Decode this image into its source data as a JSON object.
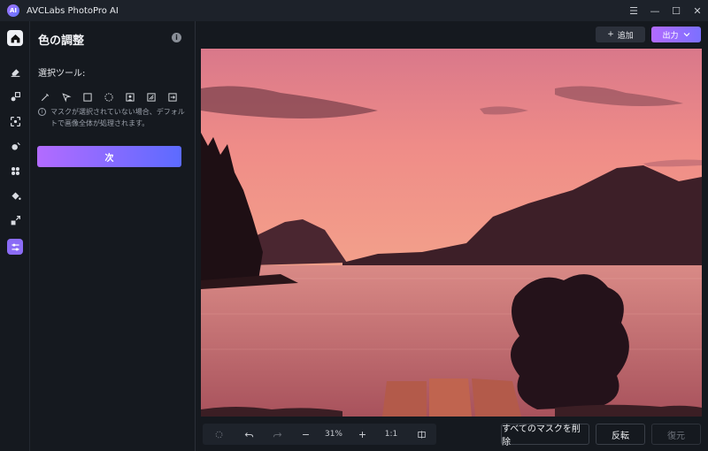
{
  "app": {
    "logo_text": "AI",
    "title": "AVCLabs PhotoPro AI"
  },
  "window_controls": {
    "menu": "☰",
    "minimize": "—",
    "maximize": "☐",
    "close": "✕"
  },
  "rail": {
    "items": [
      "home",
      "eraser",
      "object-replace",
      "enhance",
      "colorize",
      "bokeh",
      "fill",
      "upscale",
      "color-adjust"
    ],
    "active": "color-adjust"
  },
  "panel": {
    "title": "色の調整",
    "info": "i",
    "section_label": "選択ツール:",
    "tools": [
      "brush",
      "lasso",
      "rectangle",
      "ellipse",
      "portrait",
      "auto",
      "exit"
    ],
    "hint": "マスクが選択されていない場合、デフォルトで画像全体が処理されます。",
    "next_label": "次"
  },
  "toolbar": {
    "add_label": "追加",
    "add_prefix": "+",
    "export_label": "出力"
  },
  "zoom": {
    "level": "31%",
    "ratio": "1:1"
  },
  "actions": {
    "delete_masks": "すべてのマスクを削除",
    "invert": "反転",
    "restore": "復元"
  },
  "colors": {
    "accent": "#8b6cf6",
    "gradient_start": "#b36bff",
    "gradient_end": "#5c6bff",
    "panel_bg": "#15191f"
  }
}
